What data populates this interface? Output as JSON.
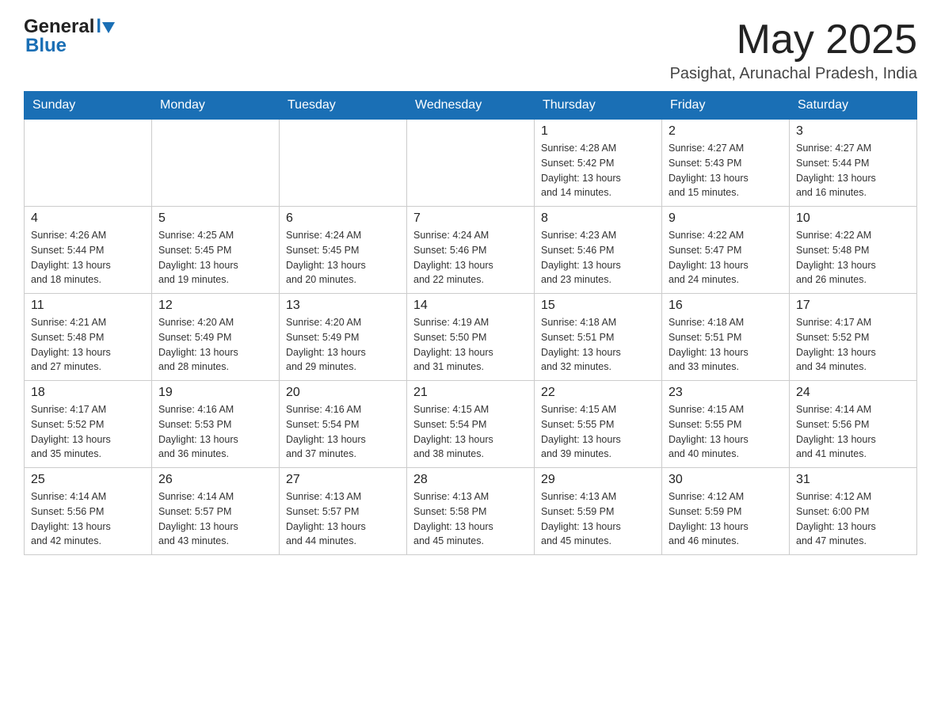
{
  "header": {
    "logo_general": "General",
    "logo_blue": "Blue",
    "month_year": "May 2025",
    "location": "Pasighat, Arunachal Pradesh, India"
  },
  "days_of_week": [
    "Sunday",
    "Monday",
    "Tuesday",
    "Wednesday",
    "Thursday",
    "Friday",
    "Saturday"
  ],
  "weeks": [
    [
      {
        "day": "",
        "info": ""
      },
      {
        "day": "",
        "info": ""
      },
      {
        "day": "",
        "info": ""
      },
      {
        "day": "",
        "info": ""
      },
      {
        "day": "1",
        "info": "Sunrise: 4:28 AM\nSunset: 5:42 PM\nDaylight: 13 hours\nand 14 minutes."
      },
      {
        "day": "2",
        "info": "Sunrise: 4:27 AM\nSunset: 5:43 PM\nDaylight: 13 hours\nand 15 minutes."
      },
      {
        "day": "3",
        "info": "Sunrise: 4:27 AM\nSunset: 5:44 PM\nDaylight: 13 hours\nand 16 minutes."
      }
    ],
    [
      {
        "day": "4",
        "info": "Sunrise: 4:26 AM\nSunset: 5:44 PM\nDaylight: 13 hours\nand 18 minutes."
      },
      {
        "day": "5",
        "info": "Sunrise: 4:25 AM\nSunset: 5:45 PM\nDaylight: 13 hours\nand 19 minutes."
      },
      {
        "day": "6",
        "info": "Sunrise: 4:24 AM\nSunset: 5:45 PM\nDaylight: 13 hours\nand 20 minutes."
      },
      {
        "day": "7",
        "info": "Sunrise: 4:24 AM\nSunset: 5:46 PM\nDaylight: 13 hours\nand 22 minutes."
      },
      {
        "day": "8",
        "info": "Sunrise: 4:23 AM\nSunset: 5:46 PM\nDaylight: 13 hours\nand 23 minutes."
      },
      {
        "day": "9",
        "info": "Sunrise: 4:22 AM\nSunset: 5:47 PM\nDaylight: 13 hours\nand 24 minutes."
      },
      {
        "day": "10",
        "info": "Sunrise: 4:22 AM\nSunset: 5:48 PM\nDaylight: 13 hours\nand 26 minutes."
      }
    ],
    [
      {
        "day": "11",
        "info": "Sunrise: 4:21 AM\nSunset: 5:48 PM\nDaylight: 13 hours\nand 27 minutes."
      },
      {
        "day": "12",
        "info": "Sunrise: 4:20 AM\nSunset: 5:49 PM\nDaylight: 13 hours\nand 28 minutes."
      },
      {
        "day": "13",
        "info": "Sunrise: 4:20 AM\nSunset: 5:49 PM\nDaylight: 13 hours\nand 29 minutes."
      },
      {
        "day": "14",
        "info": "Sunrise: 4:19 AM\nSunset: 5:50 PM\nDaylight: 13 hours\nand 31 minutes."
      },
      {
        "day": "15",
        "info": "Sunrise: 4:18 AM\nSunset: 5:51 PM\nDaylight: 13 hours\nand 32 minutes."
      },
      {
        "day": "16",
        "info": "Sunrise: 4:18 AM\nSunset: 5:51 PM\nDaylight: 13 hours\nand 33 minutes."
      },
      {
        "day": "17",
        "info": "Sunrise: 4:17 AM\nSunset: 5:52 PM\nDaylight: 13 hours\nand 34 minutes."
      }
    ],
    [
      {
        "day": "18",
        "info": "Sunrise: 4:17 AM\nSunset: 5:52 PM\nDaylight: 13 hours\nand 35 minutes."
      },
      {
        "day": "19",
        "info": "Sunrise: 4:16 AM\nSunset: 5:53 PM\nDaylight: 13 hours\nand 36 minutes."
      },
      {
        "day": "20",
        "info": "Sunrise: 4:16 AM\nSunset: 5:54 PM\nDaylight: 13 hours\nand 37 minutes."
      },
      {
        "day": "21",
        "info": "Sunrise: 4:15 AM\nSunset: 5:54 PM\nDaylight: 13 hours\nand 38 minutes."
      },
      {
        "day": "22",
        "info": "Sunrise: 4:15 AM\nSunset: 5:55 PM\nDaylight: 13 hours\nand 39 minutes."
      },
      {
        "day": "23",
        "info": "Sunrise: 4:15 AM\nSunset: 5:55 PM\nDaylight: 13 hours\nand 40 minutes."
      },
      {
        "day": "24",
        "info": "Sunrise: 4:14 AM\nSunset: 5:56 PM\nDaylight: 13 hours\nand 41 minutes."
      }
    ],
    [
      {
        "day": "25",
        "info": "Sunrise: 4:14 AM\nSunset: 5:56 PM\nDaylight: 13 hours\nand 42 minutes."
      },
      {
        "day": "26",
        "info": "Sunrise: 4:14 AM\nSunset: 5:57 PM\nDaylight: 13 hours\nand 43 minutes."
      },
      {
        "day": "27",
        "info": "Sunrise: 4:13 AM\nSunset: 5:57 PM\nDaylight: 13 hours\nand 44 minutes."
      },
      {
        "day": "28",
        "info": "Sunrise: 4:13 AM\nSunset: 5:58 PM\nDaylight: 13 hours\nand 45 minutes."
      },
      {
        "day": "29",
        "info": "Sunrise: 4:13 AM\nSunset: 5:59 PM\nDaylight: 13 hours\nand 45 minutes."
      },
      {
        "day": "30",
        "info": "Sunrise: 4:12 AM\nSunset: 5:59 PM\nDaylight: 13 hours\nand 46 minutes."
      },
      {
        "day": "31",
        "info": "Sunrise: 4:12 AM\nSunset: 6:00 PM\nDaylight: 13 hours\nand 47 minutes."
      }
    ]
  ]
}
